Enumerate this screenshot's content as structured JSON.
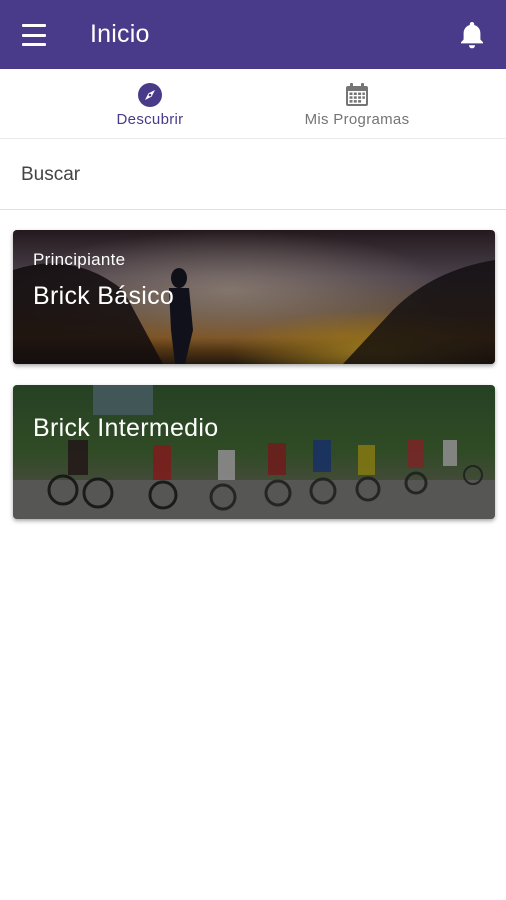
{
  "appbar": {
    "title": "Inicio",
    "menu_icon": "menu-icon",
    "notification_icon": "bell-icon",
    "color": "#4a3a8a"
  },
  "tabs": [
    {
      "label": "Descubrir",
      "icon": "compass-icon",
      "active": true
    },
    {
      "label": "Mis Programas",
      "icon": "calendar-icon",
      "active": false
    }
  ],
  "search": {
    "placeholder": "Buscar",
    "value": ""
  },
  "programs": [
    {
      "level": "Principiante",
      "name": "Brick Básico",
      "image": "runner-sunset"
    },
    {
      "level": "",
      "name": "Brick Intermedio",
      "image": "cyclists-race"
    }
  ]
}
